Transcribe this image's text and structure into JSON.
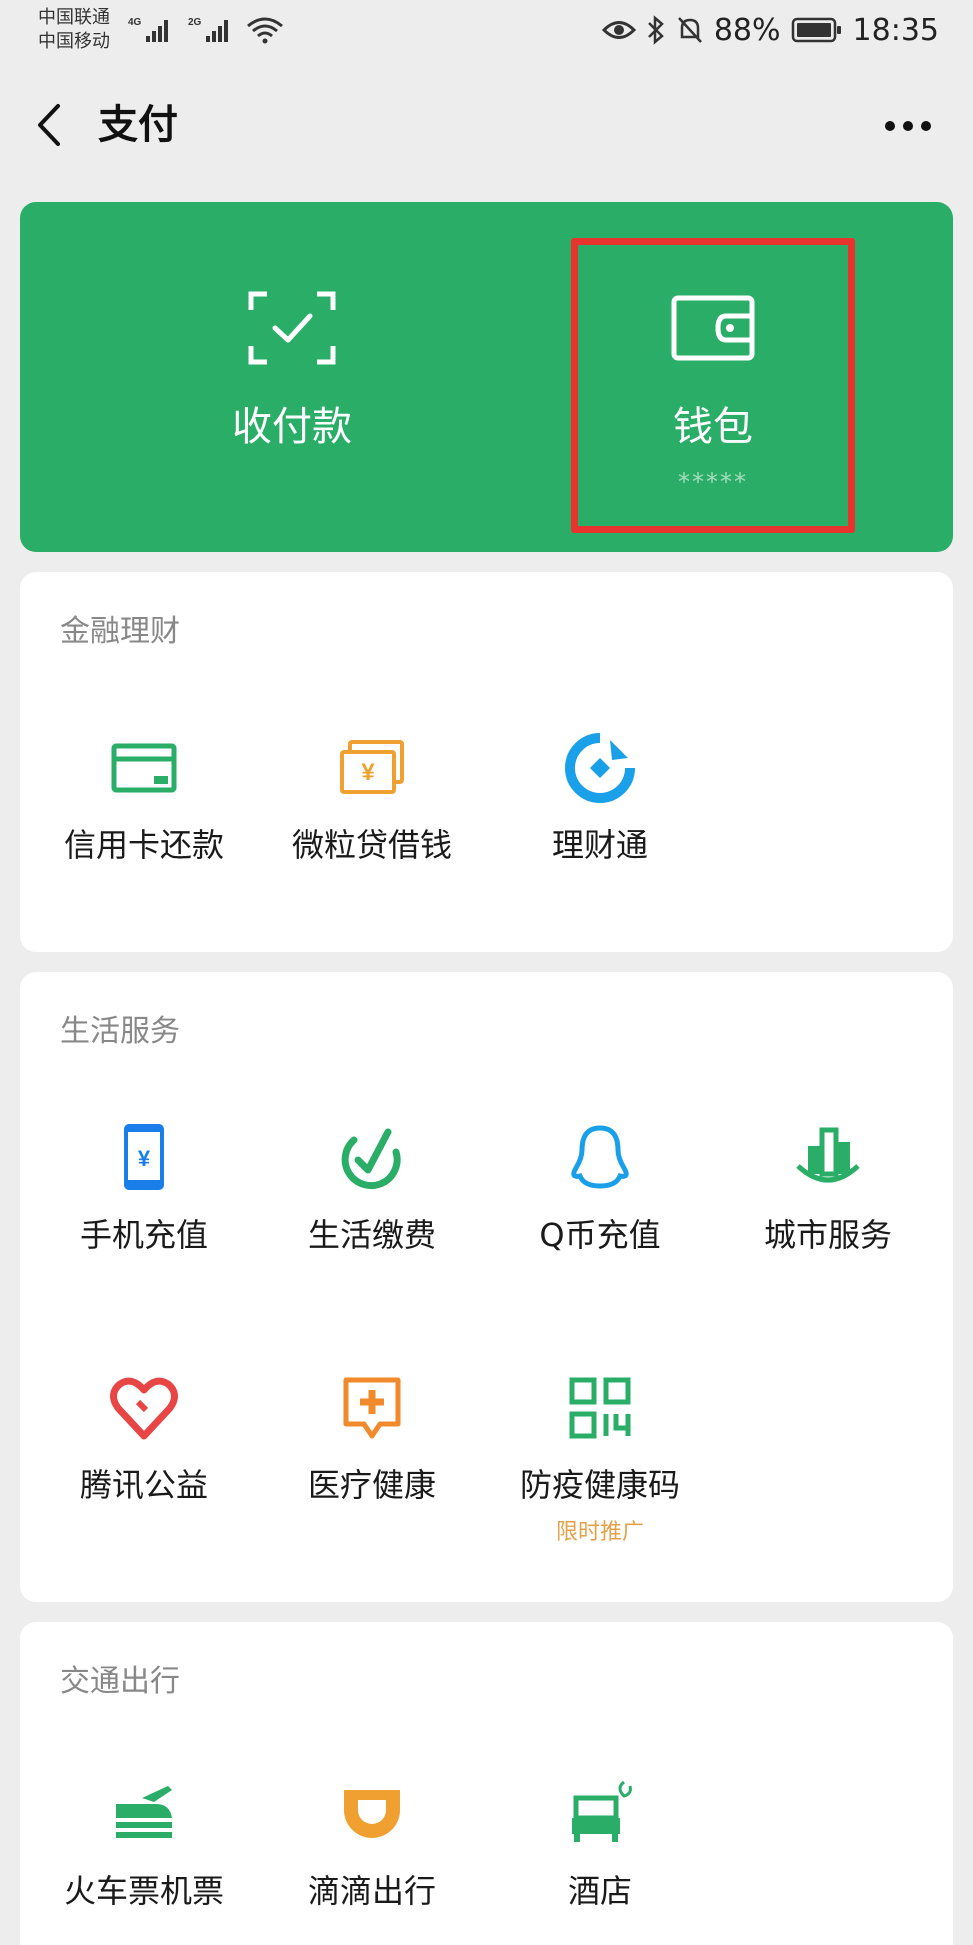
{
  "status_bar": {
    "carrier_1": "中国联通",
    "carrier_2": "中国移动",
    "net_1": "4G",
    "net_2": "2G",
    "battery": "88%",
    "time": "18:35"
  },
  "nav": {
    "title": "支付",
    "back_icon": "chevron-left-icon",
    "more_icon": "ellipsis-icon"
  },
  "pay_card": {
    "background": "#2aae67",
    "items": [
      {
        "label": "收付款",
        "icon": "scan-check-icon"
      },
      {
        "label": "钱包",
        "sub": "*****",
        "icon": "wallet-icon"
      }
    ],
    "highlight_color": "#e8332f"
  },
  "sections": [
    {
      "title": "金融理财",
      "items": [
        {
          "label": "信用卡还款",
          "icon": "credit-card-icon"
        },
        {
          "label": "微粒贷借钱",
          "icon": "yuan-bill-icon"
        },
        {
          "label": "理财通",
          "icon": "licaitong-icon"
        }
      ]
    },
    {
      "title": "生活服务",
      "items": [
        {
          "label": "手机充值",
          "icon": "phone-yuan-icon"
        },
        {
          "label": "生活缴费",
          "icon": "leaf-check-icon"
        },
        {
          "label": "Q币充值",
          "icon": "qq-penguin-icon"
        },
        {
          "label": "城市服务",
          "icon": "city-buildings-icon"
        },
        {
          "label": "腾讯公益",
          "icon": "heart-icon"
        },
        {
          "label": "医疗健康",
          "icon": "medical-chat-icon"
        },
        {
          "label": "防疫健康码",
          "sub": "限时推广",
          "icon": "qr-code-icon"
        }
      ]
    },
    {
      "title": "交通出行",
      "items": [
        {
          "label": "火车票机票",
          "icon": "train-plane-icon"
        },
        {
          "label": "滴滴出行",
          "icon": "didi-icon"
        },
        {
          "label": "酒店",
          "icon": "hotel-bed-icon"
        }
      ]
    }
  ]
}
